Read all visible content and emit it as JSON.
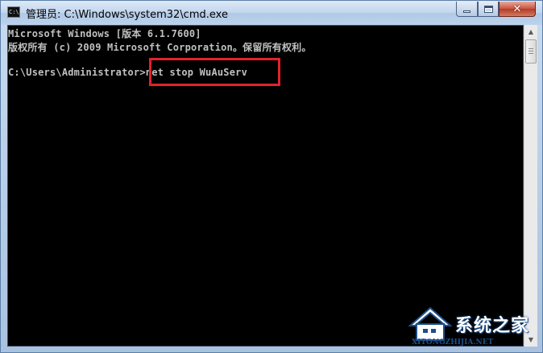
{
  "window": {
    "title": "管理员: C:\\Windows\\system32\\cmd.exe",
    "icon": "cmd-icon",
    "controls": {
      "minimize": "minimize-icon",
      "maximize": "maximize-icon",
      "close": "close-icon"
    }
  },
  "console": {
    "line1": "Microsoft Windows [版本 6.1.7600]",
    "line2": "版权所有 (c) 2009 Microsoft Corporation。保留所有权利。",
    "prompt": "C:\\Users\\Administrator>",
    "command": "net stop WuAuServ",
    "highlight_color": "#e0232b"
  },
  "watermark": {
    "brand": "系统之家",
    "url": "XITONGZHIJIA.NET"
  }
}
